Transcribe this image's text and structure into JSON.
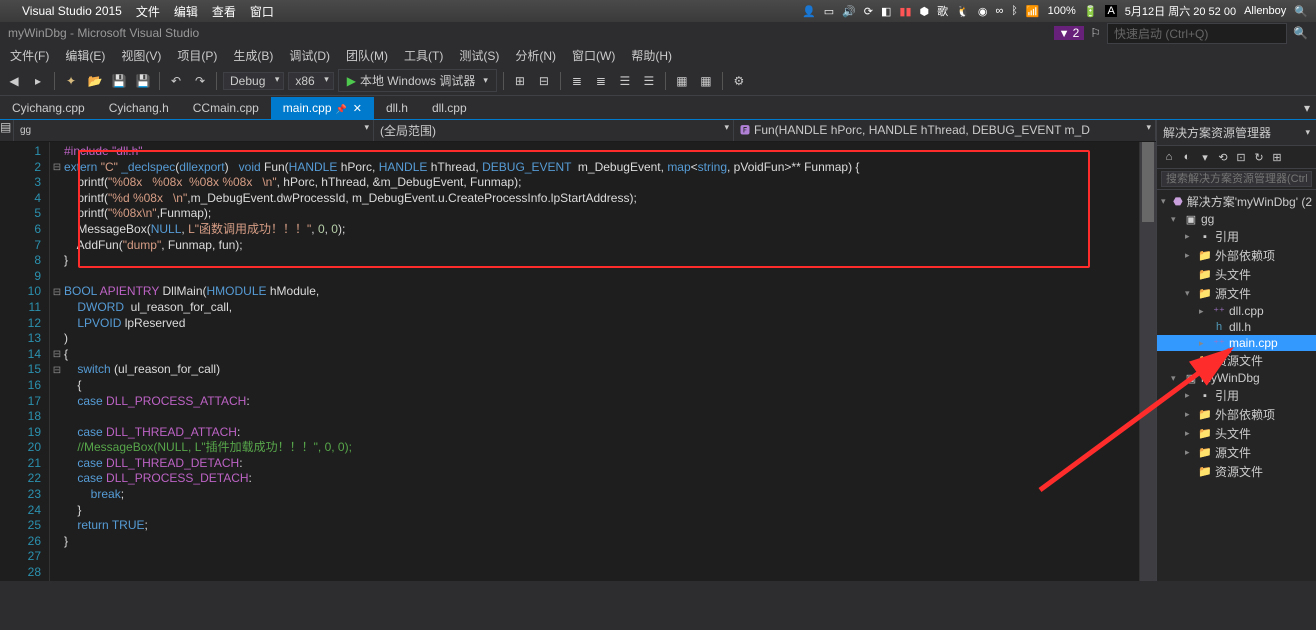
{
  "macbar": {
    "app": "Visual Studio 2015",
    "menus": [
      "文件",
      "编辑",
      "查看",
      "窗口"
    ],
    "status_right": [
      "100%",
      "5月12日 周六 20 52 00",
      "Allenboy"
    ]
  },
  "title": "myWinDbg - Microsoft Visual Studio",
  "notif": "2",
  "quick_launch_placeholder": "快速启动 (Ctrl+Q)",
  "menus": [
    "文件(F)",
    "编辑(E)",
    "视图(V)",
    "项目(P)",
    "生成(B)",
    "调试(D)",
    "团队(M)",
    "工具(T)",
    "测试(S)",
    "分析(N)",
    "窗口(W)",
    "帮助(H)"
  ],
  "toolbar": {
    "config": "Debug",
    "platform": "x86",
    "run": "本地 Windows 调试器"
  },
  "tabs": [
    "Cyichang.cpp",
    "Cyichang.h",
    "CCmain.cpp",
    "main.cpp",
    "dll.h",
    "dll.cpp"
  ],
  "active_tab": 3,
  "nav": {
    "left": "gg",
    "mid": "(全局范围)",
    "right": "Fun(HANDLE hPorc, HANDLE hThread, DEBUG_EVENT m_D"
  },
  "code_lines": [
    {
      "n": "",
      "raw": "#include \"dll.h\""
    },
    {
      "n": 1,
      "raw": "extern_line"
    },
    {
      "n": 2,
      "raw": "printf1"
    },
    {
      "n": 3,
      "raw": "printf2"
    },
    {
      "n": 4,
      "raw": "printf3"
    },
    {
      "n": 5,
      "raw": "msgbox"
    },
    {
      "n": 6,
      "raw": "addfun"
    },
    {
      "n": 7,
      "raw": "brace"
    },
    {
      "n": 8,
      "raw": ""
    },
    {
      "n": 9,
      "raw": "bool_line"
    },
    {
      "n": 10,
      "raw": "dword"
    },
    {
      "n": 11,
      "raw": "lpvoid"
    },
    {
      "n": 12,
      "raw": "paren"
    },
    {
      "n": 13,
      "raw": "obrace"
    },
    {
      "n": 14,
      "raw": "switch"
    },
    {
      "n": 15,
      "raw": "obrace2"
    },
    {
      "n": 16,
      "raw": "case1"
    },
    {
      "n": 17,
      "raw": ""
    },
    {
      "n": 18,
      "raw": "case2"
    },
    {
      "n": 19,
      "raw": "comment"
    },
    {
      "n": 20,
      "raw": "case3"
    },
    {
      "n": 21,
      "raw": "case4"
    },
    {
      "n": 22,
      "raw": "break"
    },
    {
      "n": 23,
      "raw": "cbrace"
    },
    {
      "n": 24,
      "raw": "return"
    },
    {
      "n": 25,
      "raw": "cbrace2"
    },
    {
      "n": 26,
      "raw": ""
    },
    {
      "n": 27,
      "raw": ""
    },
    {
      "n": 28,
      "raw": ""
    }
  ],
  "code": {
    "include": "#include \"dll.h\"",
    "extern": "extern \"C\" _declspec(dllexport)   void Fun(HANDLE hPorc, HANDLE hThread, DEBUG_EVENT  m_DebugEvent, map<string, pVoidFun>** Funmap) {",
    "printf1": "    printf(\"%08x   %08x  %08x %08x   \\n\", hPorc, hThread, &m_DebugEvent, Funmap);",
    "printf2": "    printf(\"%d %08x   \\n\",m_DebugEvent.dwProcessId, m_DebugEvent.u.CreateProcessInfo.lpStartAddress);",
    "printf3": "    printf(\"%08x\\n\",Funmap);",
    "msgbox": "    MessageBox(NULL, L\"函数调用成功！！！\", 0, 0);",
    "addfun": "    AddFun(\"dump\", Funmap, fun);",
    "bool": "BOOL APIENTRY DllMain(HMODULE hModule,",
    "dword": "    DWORD  ul_reason_for_call,",
    "lpvoid": "    LPVOID lpReserved",
    "switch": "    switch (ul_reason_for_call)",
    "c_attach": "    case DLL_PROCESS_ATTACH:",
    "c_tattach": "    case DLL_THREAD_ATTACH:",
    "comment": "    //MessageBox(NULL, L\"插件加载成功！！！\", 0, 0);",
    "c_tdetach": "    case DLL_THREAD_DETACH:",
    "c_pdetach": "    case DLL_PROCESS_DETACH:",
    "break": "        break;",
    "return": "    return TRUE;"
  },
  "solution": {
    "title": "解决方案资源管理器",
    "search_placeholder": "搜索解决方案资源管理器(Ctrl",
    "root": "解决方案'myWinDbg' (2",
    "items": [
      {
        "label": "gg",
        "icon": "prj",
        "ind": 1,
        "exp": "▾"
      },
      {
        "label": "引用",
        "icon": "ref",
        "ind": 2,
        "exp": "▸"
      },
      {
        "label": "外部依赖项",
        "icon": "fold",
        "ind": 2,
        "exp": "▸"
      },
      {
        "label": "头文件",
        "icon": "fold",
        "ind": 2,
        "exp": ""
      },
      {
        "label": "源文件",
        "icon": "fold",
        "ind": 2,
        "exp": "▾"
      },
      {
        "label": "dll.cpp",
        "icon": "cpp",
        "ind": 3,
        "exp": "▸"
      },
      {
        "label": "dll.h",
        "icon": "h",
        "ind": 3,
        "exp": ""
      },
      {
        "label": "main.cpp",
        "icon": "cpp",
        "ind": 3,
        "exp": "▸",
        "sel": true
      },
      {
        "label": "资源文件",
        "icon": "fold",
        "ind": 2,
        "exp": ""
      },
      {
        "label": "myWinDbg",
        "icon": "prj",
        "ind": 1,
        "exp": "▾"
      },
      {
        "label": "引用",
        "icon": "ref",
        "ind": 2,
        "exp": "▸"
      },
      {
        "label": "外部依赖项",
        "icon": "fold",
        "ind": 2,
        "exp": "▸"
      },
      {
        "label": "头文件",
        "icon": "fold",
        "ind": 2,
        "exp": "▸"
      },
      {
        "label": "源文件",
        "icon": "fold",
        "ind": 2,
        "exp": "▸"
      },
      {
        "label": "资源文件",
        "icon": "fold",
        "ind": 2,
        "exp": ""
      }
    ]
  }
}
